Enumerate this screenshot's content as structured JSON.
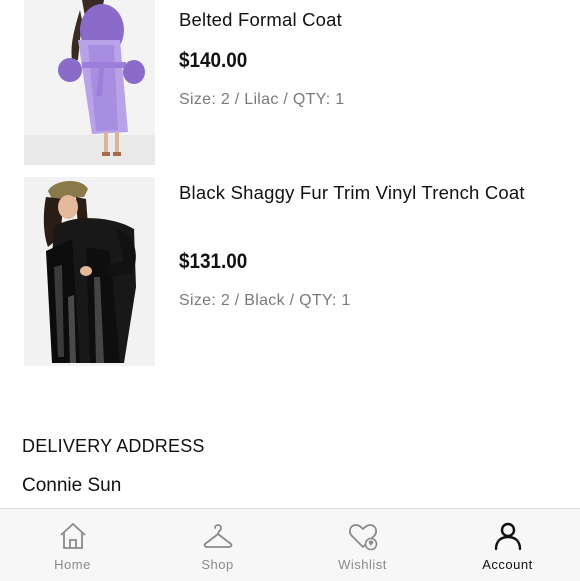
{
  "order_items": [
    {
      "name": "Belted Formal Coat",
      "price": "$140.00",
      "details": "Size: 2 / Lilac / QTY: 1",
      "image": "lilac-faux-fur-coat"
    },
    {
      "name": "Black Shaggy Fur Trim Vinyl Trench Coat",
      "price": "$131.00",
      "details": "Size: 2 / Black / QTY: 1",
      "image": "black-vinyl-trench-coat"
    }
  ],
  "delivery": {
    "title": "DELIVERY ADDRESS",
    "name": "Connie Sun"
  },
  "tabbar": {
    "items": [
      {
        "label": "Home",
        "icon": "home-icon"
      },
      {
        "label": "Shop",
        "icon": "hanger-icon"
      },
      {
        "label": "Wishlist",
        "icon": "heart-icon"
      },
      {
        "label": "Account",
        "icon": "person-icon",
        "active": true
      }
    ]
  },
  "colors": {
    "text": "#111111",
    "muted": "#7a7a7a",
    "tabbar_bg": "#f7f7f7",
    "inactive_tab": "#8a8a8a"
  }
}
